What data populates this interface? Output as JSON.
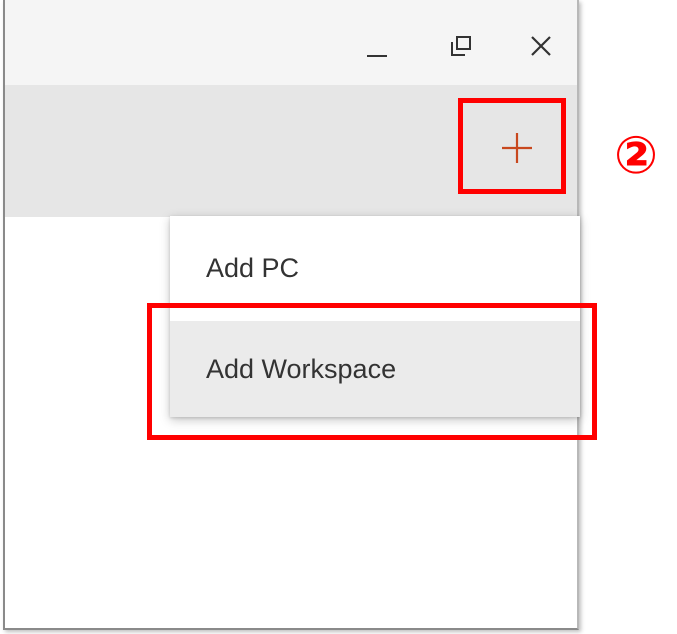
{
  "window": {
    "controls": {
      "minimize_icon": "minimize-icon",
      "restore_icon": "restore-icon",
      "close_icon": "close-icon"
    }
  },
  "toolbar": {
    "add_icon": "plus-icon",
    "add_icon_color": "#c8481e"
  },
  "menu": {
    "items": [
      {
        "label": "Add PC"
      },
      {
        "label": "Add Workspace"
      }
    ]
  },
  "annotations": {
    "step_number": "②",
    "highlight_color": "#ff0000"
  }
}
